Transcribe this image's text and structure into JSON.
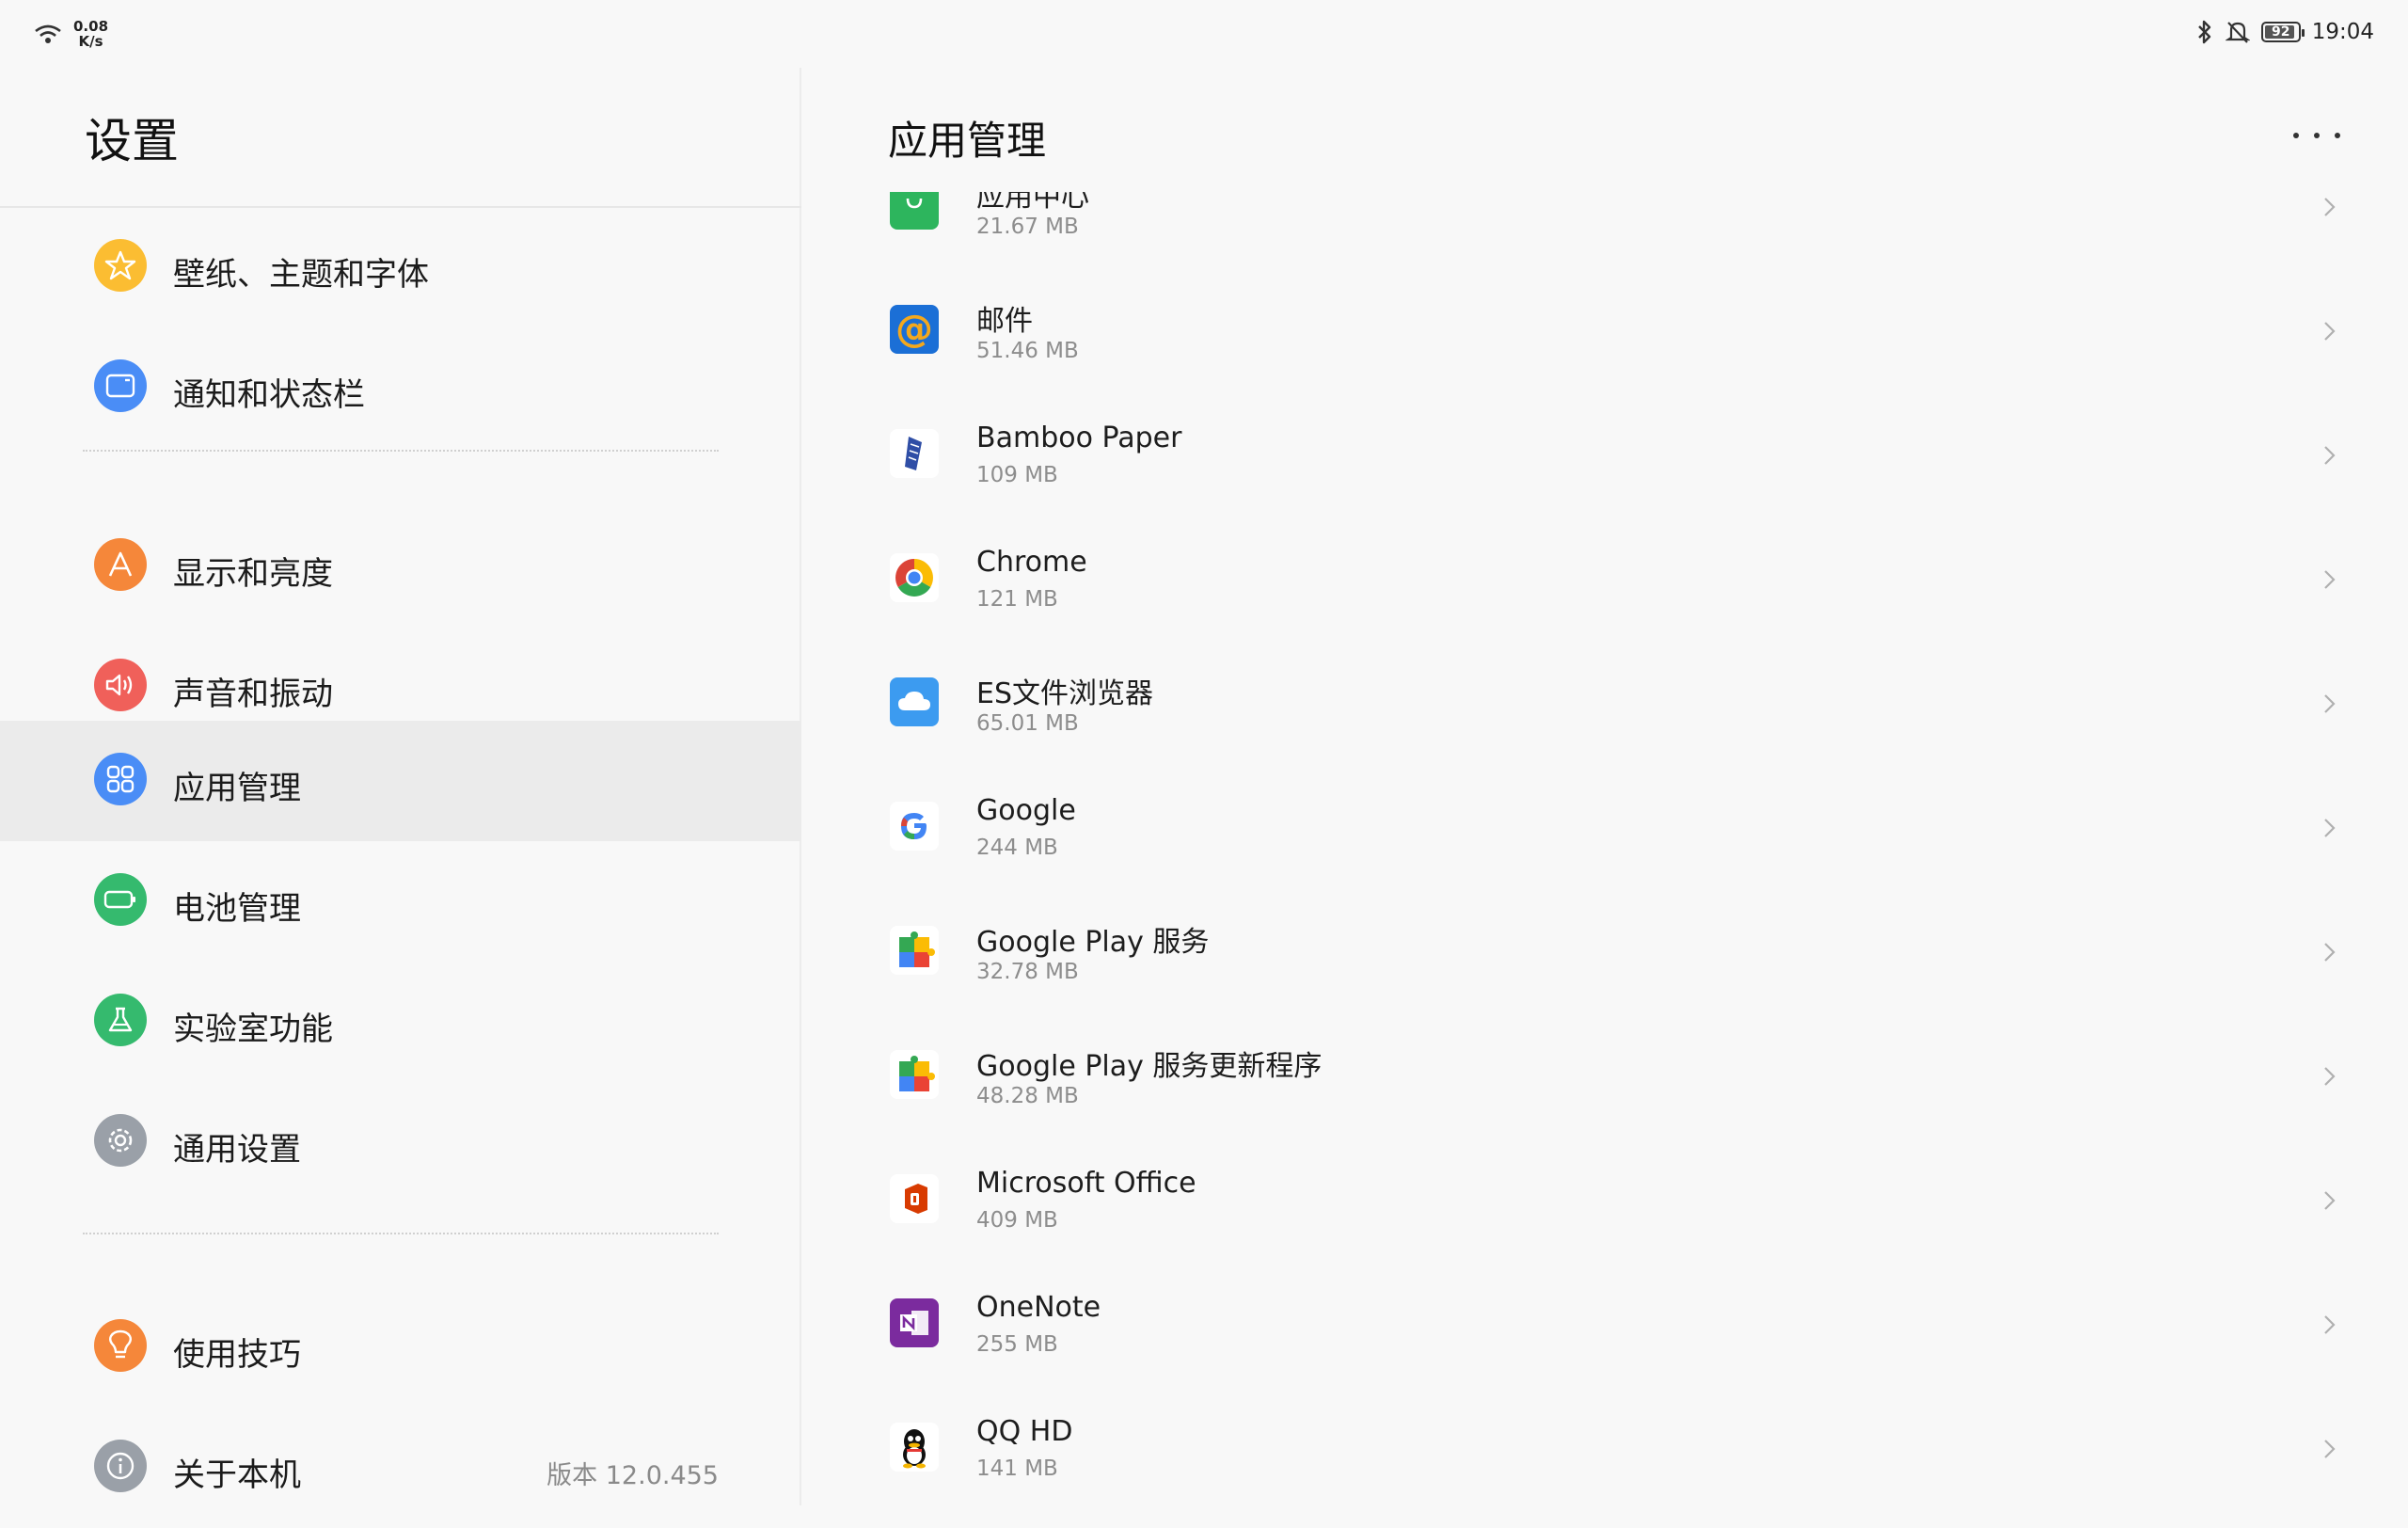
{
  "status_bar": {
    "net_speed_value": "0.08",
    "net_speed_unit": "K/s",
    "battery_level": "92",
    "time": "19:04",
    "icons": [
      "wifi-icon",
      "bluetooth-icon",
      "mute-icon",
      "battery-icon"
    ]
  },
  "left_panel": {
    "title": "设置",
    "items": [
      {
        "label": "壁纸、主题和字体",
        "icon": "theme-icon",
        "color": "#FBBD32"
      },
      {
        "label": "通知和状态栏",
        "icon": "notification-icon",
        "color": "#4A8DF6"
      },
      {
        "label": "显示和亮度",
        "icon": "display-icon",
        "color": "#F5873A"
      },
      {
        "label": "声音和振动",
        "icon": "sound-icon",
        "color": "#F0605A"
      },
      {
        "label": "应用管理",
        "icon": "apps-icon",
        "color": "#4A8DF6",
        "active": true
      },
      {
        "label": "电池管理",
        "icon": "battery-icon",
        "color": "#35BA6E"
      },
      {
        "label": "实验室功能",
        "icon": "lab-icon",
        "color": "#35BA6E"
      },
      {
        "label": "通用设置",
        "icon": "gear-icon",
        "color": "#9AA0A8"
      },
      {
        "label": "使用技巧",
        "icon": "tips-icon",
        "color": "#F5873A"
      },
      {
        "label": "关于本机",
        "icon": "info-icon",
        "color": "#9AA0A8",
        "value": "版本 12.0.455"
      }
    ]
  },
  "right_panel": {
    "title": "应用管理",
    "apps": [
      {
        "name": "应用中心",
        "size": "21.67 MB",
        "icon": "app-center-icon",
        "color": "#2DB55D"
      },
      {
        "name": "邮件",
        "size": "51.46 MB",
        "icon": "mail-icon",
        "color": "#1B6FD6"
      },
      {
        "name": "Bamboo Paper",
        "size": "109 MB",
        "icon": "bamboo-paper-icon",
        "color": "#2F4EA6"
      },
      {
        "name": "Chrome",
        "size": "121 MB",
        "icon": "chrome-icon",
        "color": "#DB4437"
      },
      {
        "name": "ES文件浏览器",
        "size": "65.01 MB",
        "icon": "es-file-explorer-icon",
        "color": "#3C9BF0"
      },
      {
        "name": "Google",
        "size": "244 MB",
        "icon": "google-icon",
        "color": "#4285F4"
      },
      {
        "name": "Google Play 服务",
        "size": "32.78 MB",
        "icon": "google-play-services-icon",
        "color": "#34A853"
      },
      {
        "name": "Google Play 服务更新程序",
        "size": "48.28 MB",
        "icon": "google-play-services-updater-icon",
        "color": "#34A853"
      },
      {
        "name": "Microsoft Office",
        "size": "409 MB",
        "icon": "microsoft-office-icon",
        "color": "#D83B01"
      },
      {
        "name": "OneNote",
        "size": "255 MB",
        "icon": "onenote-icon",
        "color": "#7B2B9E"
      },
      {
        "name": "QQ HD",
        "size": "141 MB",
        "icon": "qq-hd-icon",
        "color": "#111111"
      }
    ]
  }
}
